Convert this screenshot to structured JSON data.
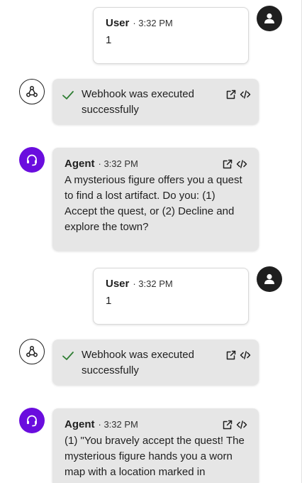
{
  "colors": {
    "agent_avatar": "#6a0dde",
    "user_avatar": "#1f1f1f",
    "check": "#2e7d32",
    "bubble_gray": "#e6e6e6"
  },
  "messages": [
    {
      "kind": "user",
      "sender": "User",
      "time": "· 3:32 PM",
      "text": "1",
      "avatar_icon": "person-icon"
    },
    {
      "kind": "webhook",
      "text": "Webhook was executed successfully",
      "status_icon": "checkmark-icon",
      "avatar_icon": "webhook-icon",
      "action_icons": [
        "open-external-icon",
        "code-icon"
      ]
    },
    {
      "kind": "agent",
      "sender": "Agent",
      "time": "· 3:32 PM",
      "text": "A mysterious figure offers you a quest to find a lost artifact. Do you: (1) Accept the quest, or (2) Decline and explore the town?",
      "avatar_icon": "headset-icon",
      "action_icons": [
        "open-external-icon",
        "code-icon"
      ]
    },
    {
      "kind": "user",
      "sender": "User",
      "time": "· 3:32 PM",
      "text": "1",
      "avatar_icon": "person-icon"
    },
    {
      "kind": "webhook",
      "text": "Webhook was executed successfully",
      "status_icon": "checkmark-icon",
      "avatar_icon": "webhook-icon",
      "action_icons": [
        "open-external-icon",
        "code-icon"
      ]
    },
    {
      "kind": "agent",
      "sender": "Agent",
      "time": "· 3:32 PM",
      "text": "(1) \"You bravely accept the quest! The mysterious figure hands you a worn map with a location marked in",
      "avatar_icon": "headset-icon",
      "action_icons": [
        "open-external-icon",
        "code-icon"
      ]
    }
  ]
}
